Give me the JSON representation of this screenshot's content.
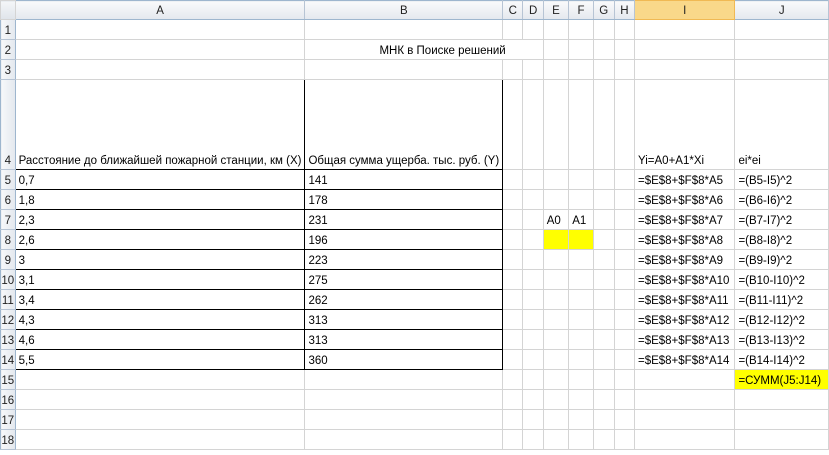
{
  "columns": [
    "A",
    "B",
    "C",
    "D",
    "E",
    "F",
    "G",
    "H",
    "I",
    "J"
  ],
  "rows": [
    "1",
    "2",
    "3",
    "4",
    "5",
    "6",
    "7",
    "8",
    "9",
    "10",
    "11",
    "12",
    "13",
    "14",
    "15",
    "16",
    "17",
    "18"
  ],
  "title": "МНК в Поиске решений",
  "header_x": "Расстояние до ближайшей пожарной станции, км (X)",
  "header_y": "Общая сумма ущерба. тыс. руб. (Y)",
  "header_yi": "Yi=A0+A1*Xi",
  "header_ei": "ei*ei",
  "param_a0": "A0",
  "param_a1": "A1",
  "data": [
    {
      "x": "0,7",
      "y": "141",
      "yi": "=$E$8+$F$8*A5",
      "ei": "=(B5-I5)^2"
    },
    {
      "x": "1,8",
      "y": "178",
      "yi": "=$E$8+$F$8*A6",
      "ei": "=(B6-I6)^2"
    },
    {
      "x": "2,3",
      "y": "231",
      "yi": "=$E$8+$F$8*A7",
      "ei": "=(B7-I7)^2"
    },
    {
      "x": "2,6",
      "y": "196",
      "yi": "=$E$8+$F$8*A8",
      "ei": "=(B8-I8)^2"
    },
    {
      "x": "3",
      "y": "223",
      "yi": "=$E$8+$F$8*A9",
      "ei": "=(B9-I9)^2"
    },
    {
      "x": "3,1",
      "y": "275",
      "yi": "=$E$8+$F$8*A10",
      "ei": "=(B10-I10)^2"
    },
    {
      "x": "3,4",
      "y": "262",
      "yi": "=$E$8+$F$8*A11",
      "ei": "=(B11-I11)^2"
    },
    {
      "x": "4,3",
      "y": "313",
      "yi": "=$E$8+$F$8*A12",
      "ei": "=(B12-I12)^2"
    },
    {
      "x": "4,6",
      "y": "313",
      "yi": "=$E$8+$F$8*A13",
      "ei": "=(B13-I13)^2"
    },
    {
      "x": "5,5",
      "y": "360",
      "yi": "=$E$8+$F$8*A14",
      "ei": "=(B14-I14)^2"
    }
  ],
  "sum_formula": "=СУММ(J5:J14)",
  "colors": {
    "highlight": "#ffff00",
    "selected_header": "#f9d88a"
  }
}
